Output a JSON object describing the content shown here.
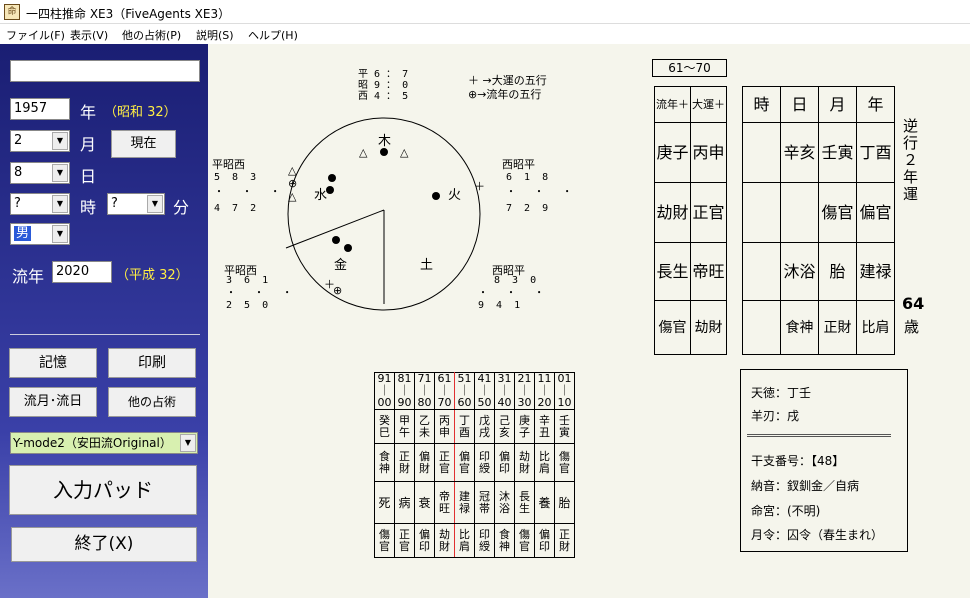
{
  "window": {
    "title": "一四柱推命 XE3（FiveAgents XE3）",
    "icon": "命"
  },
  "menu": [
    "ファイル(F)",
    "表示(V)",
    "他の占術(P)",
    "説明(S)",
    "ヘルプ(H)"
  ],
  "form": {
    "name_value": "",
    "year": "1957",
    "year_label": "年",
    "year_era": "（昭和 32）",
    "month": "2",
    "month_label": "月",
    "day": "8",
    "day_label": "日",
    "now_button": "現在",
    "hour": "?",
    "hour_label": "時",
    "minute": "?",
    "minute_label": "分",
    "gender": "男",
    "flow_label": "流年",
    "flow_year": "2020",
    "flow_era": "（平成 32）"
  },
  "buttons": {
    "memory": "記憶",
    "print": "印刷",
    "flow_month": "流月･流日",
    "other_divination": "他の占術",
    "mode": "Y-mode2（安田流Original）",
    "input_pad": "入力パッド",
    "exit": "終了(X)"
  },
  "wheel": {
    "top_lines": [
      "平 6 ： 7",
      "昭 9 ： 0",
      "西 4 ： 5"
    ],
    "legend1": "＋ →大運の五行",
    "legend2": "⊕→流年の五行",
    "elements": {
      "wood": "木",
      "fire": "火",
      "earth": "土",
      "metal": "金",
      "water": "水"
    },
    "left_upper": {
      "head": "平昭西",
      "l1": "5  8  3",
      "l2": "・   ・   ・",
      "l3": "4  7  2"
    },
    "right_upper": {
      "head": "西昭平",
      "l1": "6  1  8",
      "l2": "・   ・   ・",
      "l3": "7  2  9"
    },
    "left_lower": {
      "head": "平昭西",
      "l1": "3  6  1",
      "l2": "・   ・   ・",
      "l3": "2  5  0"
    },
    "right_lower": {
      "head": "西昭平",
      "l1": "8  3  0",
      "l2": "・   ・   ・",
      "l3": "9  4  1"
    },
    "markers": {
      "triangle": "△",
      "plus": "＋",
      "circle_plus": "⊕"
    }
  },
  "current_range": "61～70",
  "luck": {
    "headers": [
      "流年＋",
      "大運＋"
    ],
    "rows": [
      [
        "庚子",
        "丙申"
      ],
      [
        "劫財",
        "正官"
      ],
      [
        "長生",
        "帝旺"
      ],
      [
        "傷官",
        "劫財"
      ]
    ]
  },
  "pillars": {
    "headers": [
      "時",
      "日",
      "月",
      "年"
    ],
    "rows": [
      [
        "",
        "辛亥",
        "壬寅",
        "丁酉"
      ],
      [
        "",
        "",
        "傷官",
        "偏官"
      ],
      [
        "",
        "沐浴",
        "胎",
        "建禄"
      ],
      [
        "",
        "食神",
        "正財",
        "比肩"
      ]
    ]
  },
  "direction": "逆行２年運",
  "age": "64",
  "age_unit": "歳",
  "dayun": {
    "ranges": [
      "91｜00",
      "81｜90",
      "71｜80",
      "61｜70",
      "51｜60",
      "41｜50",
      "31｜40",
      "21｜30",
      "11｜20",
      "01｜10"
    ],
    "stems": [
      "癸巳",
      "甲午",
      "乙未",
      "丙申",
      "丁酉",
      "戊戌",
      "己亥",
      "庚子",
      "辛丑",
      "壬寅"
    ],
    "gods": [
      "食神",
      "正財",
      "偏財",
      "正官",
      "偏官",
      "印綬",
      "偏印",
      "劫財",
      "比肩",
      "傷官"
    ],
    "stages": [
      "死",
      "病",
      "衰",
      "帝旺",
      "建禄",
      "冠帯",
      "沐浴",
      "長生",
      "養",
      "胎"
    ],
    "hidden": [
      "傷官",
      "正官",
      "偏印",
      "劫財",
      "比肩",
      "印綬",
      "食神",
      "傷官",
      "偏印",
      "正財"
    ]
  },
  "info": {
    "tentoku": "天徳：丁壬",
    "yojin": "羊刃：戌",
    "kanshi": "干支番号：【48】",
    "nacchin": "納音：釵釧金／自病",
    "meimon": "命宮：(不明)",
    "gatsurei": "月令：囚令（春生まれ）"
  }
}
